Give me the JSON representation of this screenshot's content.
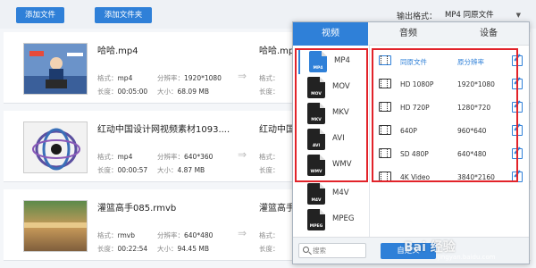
{
  "toolbar": {
    "add_file": "添加文件",
    "add_folder": "添加文件夹",
    "output_format_label": "输出格式：",
    "output_format_value": "MP4 同原文件"
  },
  "files": [
    {
      "name": "哈哈.mp4",
      "format_label": "格式：",
      "format": "mp4",
      "res_label": "分辨率：",
      "resolution": "1920*1080",
      "dur_label": "长度：",
      "duration": "00:05:00",
      "size_label": "大小：",
      "size": "68.09 MB",
      "out_name": "哈哈.mp4",
      "out_format_label": "格式：",
      "out_dur_label": "长度："
    },
    {
      "name": "红动中国设计网视频素材1093....",
      "format_label": "格式：",
      "format": "mp4",
      "res_label": "分辨率：",
      "resolution": "640*360",
      "dur_label": "长度：",
      "duration": "00:00:57",
      "size_label": "大小：",
      "size": "4.87 MB",
      "out_name": "红动中国设计网视频素",
      "out_format_label": "格式：",
      "out_dur_label": "长度："
    },
    {
      "name": "灌篮高手085.rmvb",
      "format_label": "格式：",
      "format": "rmvb",
      "res_label": "分辨率：",
      "resolution": "640*480",
      "dur_label": "长度：",
      "duration": "00:22:54",
      "size_label": "大小：",
      "size": "94.45 MB",
      "out_name": "灌篮高手085.",
      "out_format_label": "格式：",
      "out_dur_label": "长度："
    }
  ],
  "panel": {
    "tabs": [
      "视频",
      "音频",
      "设备"
    ],
    "formats": [
      {
        "label": "MP4",
        "icon_tag": "MP4"
      },
      {
        "label": "MOV",
        "icon_tag": "MOV"
      },
      {
        "label": "MKV",
        "icon_tag": "MKV"
      },
      {
        "label": "AVI",
        "icon_tag": "AVI"
      },
      {
        "label": "WMV",
        "icon_tag": "WMV"
      },
      {
        "label": "M4V",
        "icon_tag": "M4V"
      },
      {
        "label": "MPEG",
        "icon_tag": "MPEG"
      }
    ],
    "resolutions": [
      {
        "name": "同原文件",
        "value": "原分辨率"
      },
      {
        "name": "HD 1080P",
        "value": "1920*1080"
      },
      {
        "name": "HD 720P",
        "value": "1280*720"
      },
      {
        "name": "640P",
        "value": "960*640"
      },
      {
        "name": "SD 480P",
        "value": "640*480"
      },
      {
        "name": "4K Video",
        "value": "3840*2160"
      }
    ],
    "search_placeholder": "搜索",
    "custom_button": "自定义"
  },
  "watermark": {
    "text": "Bai 经验",
    "url": "jingyan.baidu.com"
  },
  "colors": {
    "accent": "#2f80d8",
    "highlight_box": "#e2232a"
  }
}
